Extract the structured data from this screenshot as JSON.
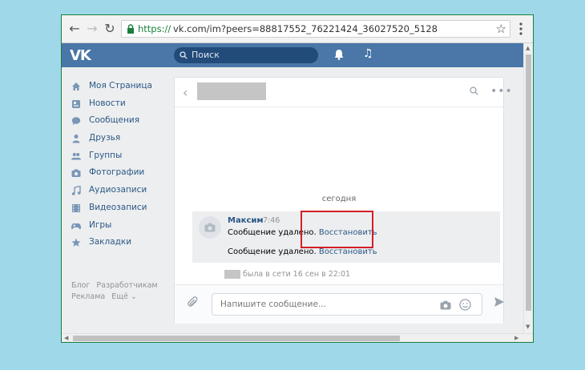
{
  "browser": {
    "url_protocol": "https://",
    "url_rest": "vk.com/im?peers=88817552_76221424_36027520_5128",
    "back_label": "←",
    "forward_label": "→",
    "reload_label": "↻",
    "star_label": "☆"
  },
  "header": {
    "logo": "VK",
    "search_placeholder": "Поиск",
    "music_icon": "♫"
  },
  "sidebar": {
    "items": [
      {
        "label": "Моя Страница",
        "icon": "home-icon"
      },
      {
        "label": "Новости",
        "icon": "news-icon"
      },
      {
        "label": "Сообщения",
        "icon": "messages-icon"
      },
      {
        "label": "Друзья",
        "icon": "friends-icon"
      },
      {
        "label": "Группы",
        "icon": "groups-icon"
      },
      {
        "label": "Фотографии",
        "icon": "photos-icon"
      },
      {
        "label": "Аудиозаписи",
        "icon": "audio-icon"
      },
      {
        "label": "Видеозаписи",
        "icon": "video-icon"
      },
      {
        "label": "Игры",
        "icon": "games-icon"
      },
      {
        "label": "Закладки",
        "icon": "bookmarks-icon"
      }
    ],
    "footer": {
      "blog": "Блог",
      "developers": "Разработчикам",
      "ads": "Реклама",
      "more": "Ещё ⌄"
    }
  },
  "chat": {
    "back": "‹",
    "more": "•••",
    "day_label": "сегодня",
    "author": "Максим",
    "time": "7:46",
    "messages": [
      {
        "text": "Сообщение удалено.",
        "action": "Восстановить"
      },
      {
        "text": "Сообщение удалено.",
        "action": "Восстановить"
      }
    ],
    "last_seen": "была в сети 16 сен в 22:01",
    "input_placeholder": "Напишите сообщение..."
  },
  "colors": {
    "vk_blue": "#4a76a8",
    "link": "#2a5885",
    "highlight": "#d41f26"
  }
}
